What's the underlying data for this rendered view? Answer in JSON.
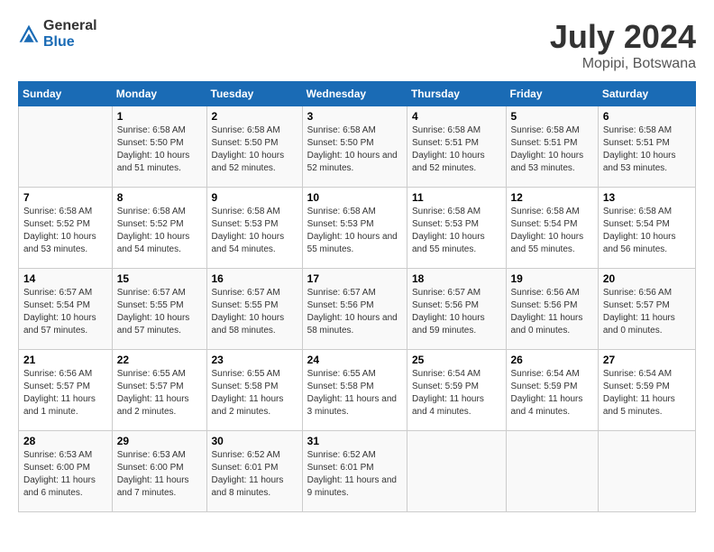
{
  "logo": {
    "general": "General",
    "blue": "Blue"
  },
  "title": "July 2024",
  "location": "Mopipi, Botswana",
  "days_of_week": [
    "Sunday",
    "Monday",
    "Tuesday",
    "Wednesday",
    "Thursday",
    "Friday",
    "Saturday"
  ],
  "weeks": [
    [
      {
        "day": null,
        "info": null
      },
      {
        "day": "1",
        "sunrise": "6:58 AM",
        "sunset": "5:50 PM",
        "daylight": "10 hours and 51 minutes."
      },
      {
        "day": "2",
        "sunrise": "6:58 AM",
        "sunset": "5:50 PM",
        "daylight": "10 hours and 52 minutes."
      },
      {
        "day": "3",
        "sunrise": "6:58 AM",
        "sunset": "5:50 PM",
        "daylight": "10 hours and 52 minutes."
      },
      {
        "day": "4",
        "sunrise": "6:58 AM",
        "sunset": "5:51 PM",
        "daylight": "10 hours and 52 minutes."
      },
      {
        "day": "5",
        "sunrise": "6:58 AM",
        "sunset": "5:51 PM",
        "daylight": "10 hours and 53 minutes."
      },
      {
        "day": "6",
        "sunrise": "6:58 AM",
        "sunset": "5:51 PM",
        "daylight": "10 hours and 53 minutes."
      }
    ],
    [
      {
        "day": "7",
        "sunrise": "6:58 AM",
        "sunset": "5:52 PM",
        "daylight": "10 hours and 53 minutes."
      },
      {
        "day": "8",
        "sunrise": "6:58 AM",
        "sunset": "5:52 PM",
        "daylight": "10 hours and 54 minutes."
      },
      {
        "day": "9",
        "sunrise": "6:58 AM",
        "sunset": "5:53 PM",
        "daylight": "10 hours and 54 minutes."
      },
      {
        "day": "10",
        "sunrise": "6:58 AM",
        "sunset": "5:53 PM",
        "daylight": "10 hours and 55 minutes."
      },
      {
        "day": "11",
        "sunrise": "6:58 AM",
        "sunset": "5:53 PM",
        "daylight": "10 hours and 55 minutes."
      },
      {
        "day": "12",
        "sunrise": "6:58 AM",
        "sunset": "5:54 PM",
        "daylight": "10 hours and 55 minutes."
      },
      {
        "day": "13",
        "sunrise": "6:58 AM",
        "sunset": "5:54 PM",
        "daylight": "10 hours and 56 minutes."
      }
    ],
    [
      {
        "day": "14",
        "sunrise": "6:57 AM",
        "sunset": "5:54 PM",
        "daylight": "10 hours and 57 minutes."
      },
      {
        "day": "15",
        "sunrise": "6:57 AM",
        "sunset": "5:55 PM",
        "daylight": "10 hours and 57 minutes."
      },
      {
        "day": "16",
        "sunrise": "6:57 AM",
        "sunset": "5:55 PM",
        "daylight": "10 hours and 58 minutes."
      },
      {
        "day": "17",
        "sunrise": "6:57 AM",
        "sunset": "5:56 PM",
        "daylight": "10 hours and 58 minutes."
      },
      {
        "day": "18",
        "sunrise": "6:57 AM",
        "sunset": "5:56 PM",
        "daylight": "10 hours and 59 minutes."
      },
      {
        "day": "19",
        "sunrise": "6:56 AM",
        "sunset": "5:56 PM",
        "daylight": "11 hours and 0 minutes."
      },
      {
        "day": "20",
        "sunrise": "6:56 AM",
        "sunset": "5:57 PM",
        "daylight": "11 hours and 0 minutes."
      }
    ],
    [
      {
        "day": "21",
        "sunrise": "6:56 AM",
        "sunset": "5:57 PM",
        "daylight": "11 hours and 1 minute."
      },
      {
        "day": "22",
        "sunrise": "6:55 AM",
        "sunset": "5:57 PM",
        "daylight": "11 hours and 2 minutes."
      },
      {
        "day": "23",
        "sunrise": "6:55 AM",
        "sunset": "5:58 PM",
        "daylight": "11 hours and 2 minutes."
      },
      {
        "day": "24",
        "sunrise": "6:55 AM",
        "sunset": "5:58 PM",
        "daylight": "11 hours and 3 minutes."
      },
      {
        "day": "25",
        "sunrise": "6:54 AM",
        "sunset": "5:59 PM",
        "daylight": "11 hours and 4 minutes."
      },
      {
        "day": "26",
        "sunrise": "6:54 AM",
        "sunset": "5:59 PM",
        "daylight": "11 hours and 4 minutes."
      },
      {
        "day": "27",
        "sunrise": "6:54 AM",
        "sunset": "5:59 PM",
        "daylight": "11 hours and 5 minutes."
      }
    ],
    [
      {
        "day": "28",
        "sunrise": "6:53 AM",
        "sunset": "6:00 PM",
        "daylight": "11 hours and 6 minutes."
      },
      {
        "day": "29",
        "sunrise": "6:53 AM",
        "sunset": "6:00 PM",
        "daylight": "11 hours and 7 minutes."
      },
      {
        "day": "30",
        "sunrise": "6:52 AM",
        "sunset": "6:01 PM",
        "daylight": "11 hours and 8 minutes."
      },
      {
        "day": "31",
        "sunrise": "6:52 AM",
        "sunset": "6:01 PM",
        "daylight": "11 hours and 9 minutes."
      },
      {
        "day": null,
        "info": null
      },
      {
        "day": null,
        "info": null
      },
      {
        "day": null,
        "info": null
      }
    ]
  ]
}
